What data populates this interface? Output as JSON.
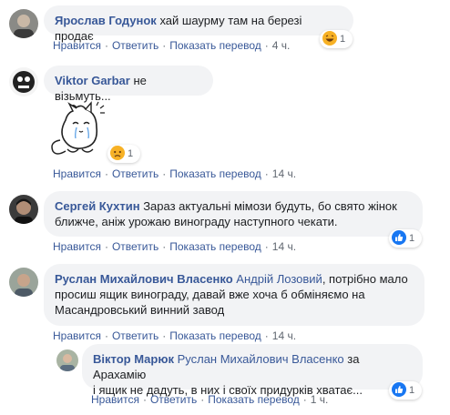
{
  "comments": [
    {
      "author": "Ярослав Годунок",
      "text": "хай шаурму там на березі продає",
      "actions": [
        "Нравится",
        "Ответить",
        "Показать перевод"
      ],
      "time": "4 ч.",
      "reaction": {
        "icon": "haha-icon",
        "count": "1"
      }
    },
    {
      "author": "Viktor Garbar",
      "text": "не візьмуть...",
      "sticker": "crying-cat-sticker",
      "actions": [
        "Нравится",
        "Ответить",
        "Показать перевод"
      ],
      "time": "14 ч.",
      "reaction": {
        "icon": "sad-icon",
        "count": "1"
      }
    },
    {
      "author": "Сергей Кухтин",
      "text_line1": "Зараз актуальні мімози будуть, бо свято жінок",
      "text_line2": "ближче, аніж урожаю винограду наступного чекати.",
      "actions": [
        "Нравится",
        "Ответить",
        "Показать перевод"
      ],
      "time": "14 ч.",
      "reaction": {
        "icon": "like-icon",
        "count": "1"
      }
    },
    {
      "author": "Руслан Михайлович Власенко",
      "mention": "Андрій Лозовий",
      "text_line1_rest": ", потрібно мало",
      "text_line2": "просиш ящик винограду, давай вже хоча б обміняємо на",
      "text_line3": "Масандровський винний завод",
      "actions": [
        "Нравится",
        "Ответить",
        "Показать перевод"
      ],
      "time": "14 ч."
    },
    {
      "author": "Віктор Марюк",
      "mention": "Руслан Михайлович Власенко",
      "text_line1_rest": " за Арахамію",
      "text_line2": "і ящик не дадуть, в них і своїх придурків хватає...",
      "actions": [
        "Нравится",
        "Ответить",
        "Показать перевод"
      ],
      "time": "1 ч.",
      "reaction": {
        "icon": "like-icon",
        "count": "1"
      }
    }
  ],
  "colors": {
    "link": "#385898",
    "bubble": "#f2f3f5",
    "meta": "#606770",
    "like": "#1877f2",
    "emoji": "#f7b125"
  }
}
